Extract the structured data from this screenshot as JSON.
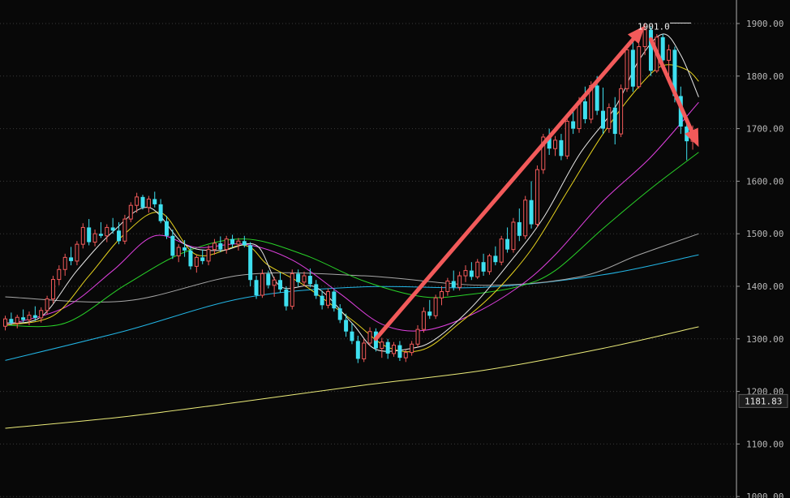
{
  "chart_data": {
    "type": "candlestick",
    "ylim": [
      1100,
      1901
    ],
    "y_ticks": [
      "1900.00",
      "1800.00",
      "1700.00",
      "1600.00",
      "1500.00",
      "1400.00",
      "1300.00",
      "1200.00",
      "1100.00",
      "1000.00"
    ],
    "current_price_tag": "1181.83",
    "peak_label": "1901.0",
    "peak_value": 1901,
    "colors": {
      "up": "#f25a5a",
      "down": "#3ee0f0",
      "background": "#080808",
      "grid": "#3a3a3a",
      "arrow": "#f25a5a",
      "ma5": "#e8e8e8",
      "ma10": "#e6d21e",
      "ma20": "#e040e0",
      "ma30": "#28d228",
      "ma60": "#a8a8a8",
      "ma120": "#22b6e6",
      "ma250": "#ecec7a"
    },
    "candles": [
      [
        1324,
        1344,
        1316,
        1338
      ],
      [
        1338,
        1350,
        1326,
        1330
      ],
      [
        1330,
        1346,
        1320,
        1341
      ],
      [
        1341,
        1356,
        1332,
        1336
      ],
      [
        1336,
        1352,
        1326,
        1345
      ],
      [
        1345,
        1362,
        1334,
        1340
      ],
      [
        1340,
        1360,
        1331,
        1354
      ],
      [
        1354,
        1382,
        1346,
        1376
      ],
      [
        1376,
        1420,
        1368,
        1413
      ],
      [
        1413,
        1440,
        1402,
        1432
      ],
      [
        1432,
        1462,
        1420,
        1455
      ],
      [
        1455,
        1475,
        1440,
        1448
      ],
      [
        1448,
        1486,
        1440,
        1480
      ],
      [
        1480,
        1520,
        1472,
        1512
      ],
      [
        1512,
        1528,
        1478,
        1484
      ],
      [
        1484,
        1508,
        1476,
        1500
      ],
      [
        1500,
        1522,
        1492,
        1496
      ],
      [
        1496,
        1518,
        1484,
        1512
      ],
      [
        1512,
        1530,
        1500,
        1506
      ],
      [
        1506,
        1522,
        1480,
        1486
      ],
      [
        1486,
        1536,
        1480,
        1528
      ],
      [
        1528,
        1560,
        1522,
        1554
      ],
      [
        1554,
        1578,
        1540,
        1570
      ],
      [
        1570,
        1574,
        1546,
        1550
      ],
      [
        1550,
        1572,
        1540,
        1566
      ],
      [
        1566,
        1580,
        1550,
        1556
      ],
      [
        1556,
        1566,
        1520,
        1524
      ],
      [
        1524,
        1534,
        1490,
        1496
      ],
      [
        1496,
        1508,
        1452,
        1458
      ],
      [
        1458,
        1480,
        1446,
        1474
      ],
      [
        1474,
        1488,
        1456,
        1468
      ],
      [
        1468,
        1476,
        1432,
        1438
      ],
      [
        1438,
        1460,
        1426,
        1455
      ],
      [
        1455,
        1470,
        1442,
        1448
      ],
      [
        1448,
        1478,
        1440,
        1470
      ],
      [
        1470,
        1490,
        1460,
        1482
      ],
      [
        1482,
        1495,
        1465,
        1470
      ],
      [
        1470,
        1496,
        1462,
        1490
      ],
      [
        1490,
        1498,
        1474,
        1480
      ],
      [
        1480,
        1492,
        1468,
        1486
      ],
      [
        1486,
        1496,
        1474,
        1478
      ],
      [
        1478,
        1484,
        1400,
        1412
      ],
      [
        1412,
        1420,
        1376,
        1383
      ],
      [
        1383,
        1432,
        1378,
        1424
      ],
      [
        1424,
        1430,
        1396,
        1402
      ],
      [
        1402,
        1418,
        1380,
        1412
      ],
      [
        1412,
        1426,
        1388,
        1394
      ],
      [
        1394,
        1400,
        1354,
        1362
      ],
      [
        1362,
        1432,
        1356,
        1424
      ],
      [
        1424,
        1432,
        1400,
        1408
      ],
      [
        1408,
        1428,
        1400,
        1420
      ],
      [
        1420,
        1434,
        1398,
        1404
      ],
      [
        1404,
        1412,
        1376,
        1382
      ],
      [
        1382,
        1392,
        1356,
        1364
      ],
      [
        1364,
        1396,
        1358,
        1390
      ],
      [
        1390,
        1394,
        1352,
        1358
      ],
      [
        1358,
        1366,
        1330,
        1336
      ],
      [
        1336,
        1348,
        1304,
        1314
      ],
      [
        1314,
        1330,
        1290,
        1296
      ],
      [
        1296,
        1306,
        1254,
        1262
      ],
      [
        1262,
        1300,
        1256,
        1292
      ],
      [
        1292,
        1322,
        1286,
        1314
      ],
      [
        1314,
        1320,
        1276,
        1282
      ],
      [
        1282,
        1302,
        1264,
        1294
      ],
      [
        1294,
        1300,
        1262,
        1272
      ],
      [
        1272,
        1294,
        1266,
        1288
      ],
      [
        1288,
        1296,
        1258,
        1264
      ],
      [
        1264,
        1280,
        1256,
        1274
      ],
      [
        1274,
        1296,
        1268,
        1290
      ],
      [
        1290,
        1326,
        1284,
        1318
      ],
      [
        1318,
        1360,
        1312,
        1352
      ],
      [
        1352,
        1374,
        1338,
        1344
      ],
      [
        1344,
        1384,
        1338,
        1378
      ],
      [
        1378,
        1400,
        1364,
        1390
      ],
      [
        1390,
        1416,
        1382,
        1410
      ],
      [
        1410,
        1430,
        1392,
        1398
      ],
      [
        1398,
        1428,
        1392,
        1420
      ],
      [
        1420,
        1440,
        1408,
        1430
      ],
      [
        1430,
        1446,
        1412,
        1418
      ],
      [
        1418,
        1452,
        1414,
        1446
      ],
      [
        1446,
        1462,
        1420,
        1428
      ],
      [
        1428,
        1462,
        1422,
        1458
      ],
      [
        1458,
        1476,
        1440,
        1446
      ],
      [
        1446,
        1496,
        1440,
        1490
      ],
      [
        1490,
        1512,
        1464,
        1470
      ],
      [
        1470,
        1530,
        1464,
        1522
      ],
      [
        1522,
        1548,
        1486,
        1496
      ],
      [
        1496,
        1572,
        1490,
        1564
      ],
      [
        1564,
        1600,
        1510,
        1518
      ],
      [
        1518,
        1630,
        1512,
        1622
      ],
      [
        1622,
        1690,
        1614,
        1684
      ],
      [
        1684,
        1700,
        1650,
        1662
      ],
      [
        1662,
        1686,
        1648,
        1678
      ],
      [
        1678,
        1690,
        1640,
        1648
      ],
      [
        1648,
        1720,
        1642,
        1714
      ],
      [
        1714,
        1740,
        1690,
        1700
      ],
      [
        1700,
        1760,
        1692,
        1752
      ],
      [
        1752,
        1780,
        1710,
        1718
      ],
      [
        1718,
        1790,
        1710,
        1782
      ],
      [
        1782,
        1800,
        1726,
        1734
      ],
      [
        1734,
        1778,
        1690,
        1700
      ],
      [
        1700,
        1748,
        1692,
        1740
      ],
      [
        1740,
        1760,
        1670,
        1690
      ],
      [
        1690,
        1784,
        1684,
        1776
      ],
      [
        1776,
        1860,
        1770,
        1850
      ],
      [
        1850,
        1880,
        1770,
        1780
      ],
      [
        1780,
        1862,
        1776,
        1856
      ],
      [
        1856,
        1901,
        1840,
        1888
      ],
      [
        1888,
        1894,
        1800,
        1810
      ],
      [
        1810,
        1880,
        1806,
        1874
      ],
      [
        1874,
        1880,
        1822,
        1830
      ],
      [
        1830,
        1860,
        1790,
        1850
      ],
      [
        1850,
        1856,
        1750,
        1762
      ],
      [
        1762,
        1780,
        1690,
        1704
      ],
      [
        1704,
        1712,
        1640,
        1676
      ],
      [
        1676,
        1706,
        1660,
        1692
      ]
    ],
    "ma_curves": [
      {
        "name": "MA250",
        "color_key": "ma250",
        "knots": [
          [
            0,
            1130
          ],
          [
            20,
            1152
          ],
          [
            40,
            1181
          ],
          [
            60,
            1212
          ],
          [
            80,
            1240
          ],
          [
            100,
            1282
          ],
          [
            116,
            1323
          ]
        ]
      },
      {
        "name": "MA120",
        "color_key": "ma120",
        "knots": [
          [
            0,
            1259
          ],
          [
            20,
            1315
          ],
          [
            40,
            1378
          ],
          [
            60,
            1399
          ],
          [
            80,
            1398
          ],
          [
            100,
            1422
          ],
          [
            116,
            1460
          ]
        ]
      },
      {
        "name": "MA60",
        "color_key": "ma60",
        "knots": [
          [
            0,
            1380
          ],
          [
            20,
            1372
          ],
          [
            40,
            1422
          ],
          [
            60,
            1420
          ],
          [
            80,
            1402
          ],
          [
            96,
            1418
          ],
          [
            106,
            1460
          ],
          [
            116,
            1500
          ]
        ]
      },
      {
        "name": "MA30",
        "color_key": "ma30",
        "knots": [
          [
            0,
            1326
          ],
          [
            10,
            1330
          ],
          [
            20,
            1402
          ],
          [
            30,
            1465
          ],
          [
            40,
            1490
          ],
          [
            50,
            1460
          ],
          [
            60,
            1410
          ],
          [
            70,
            1380
          ],
          [
            78,
            1385
          ],
          [
            86,
            1400
          ],
          [
            92,
            1430
          ],
          [
            100,
            1510
          ],
          [
            108,
            1586
          ],
          [
            116,
            1655
          ]
        ]
      },
      {
        "name": "MA20",
        "color_key": "ma20",
        "knots": [
          [
            0,
            1326
          ],
          [
            10,
            1360
          ],
          [
            18,
            1430
          ],
          [
            25,
            1496
          ],
          [
            32,
            1474
          ],
          [
            40,
            1480
          ],
          [
            48,
            1450
          ],
          [
            56,
            1386
          ],
          [
            63,
            1328
          ],
          [
            70,
            1316
          ],
          [
            78,
            1346
          ],
          [
            86,
            1400
          ],
          [
            92,
            1460
          ],
          [
            100,
            1562
          ],
          [
            108,
            1646
          ],
          [
            116,
            1750
          ]
        ]
      },
      {
        "name": "MA10",
        "color_key": "ma10",
        "knots": [
          [
            0,
            1326
          ],
          [
            8,
            1344
          ],
          [
            14,
            1420
          ],
          [
            20,
            1500
          ],
          [
            26,
            1540
          ],
          [
            32,
            1460
          ],
          [
            40,
            1478
          ],
          [
            44,
            1440
          ],
          [
            50,
            1402
          ],
          [
            58,
            1336
          ],
          [
            64,
            1284
          ],
          [
            70,
            1280
          ],
          [
            76,
            1330
          ],
          [
            82,
            1390
          ],
          [
            88,
            1470
          ],
          [
            94,
            1580
          ],
          [
            100,
            1690
          ],
          [
            106,
            1780
          ],
          [
            110,
            1820
          ],
          [
            114,
            1812
          ],
          [
            116,
            1790
          ]
        ]
      },
      {
        "name": "MA5",
        "color_key": "ma5",
        "knots": [
          [
            0,
            1330
          ],
          [
            6,
            1342
          ],
          [
            12,
            1430
          ],
          [
            18,
            1504
          ],
          [
            24,
            1550
          ],
          [
            30,
            1480
          ],
          [
            36,
            1468
          ],
          [
            42,
            1478
          ],
          [
            46,
            1400
          ],
          [
            52,
            1398
          ],
          [
            58,
            1330
          ],
          [
            62,
            1280
          ],
          [
            68,
            1282
          ],
          [
            72,
            1300
          ],
          [
            78,
            1360
          ],
          [
            84,
            1440
          ],
          [
            90,
            1530
          ],
          [
            96,
            1650
          ],
          [
            102,
            1740
          ],
          [
            106,
            1830
          ],
          [
            110,
            1880
          ],
          [
            113,
            1840
          ],
          [
            116,
            1760
          ]
        ]
      }
    ],
    "arrows": [
      {
        "from": [
          62,
          1300
        ],
        "to": [
          107,
          1896
        ]
      },
      {
        "from": [
          108,
          1870
        ],
        "to": [
          116,
          1665
        ]
      }
    ]
  }
}
